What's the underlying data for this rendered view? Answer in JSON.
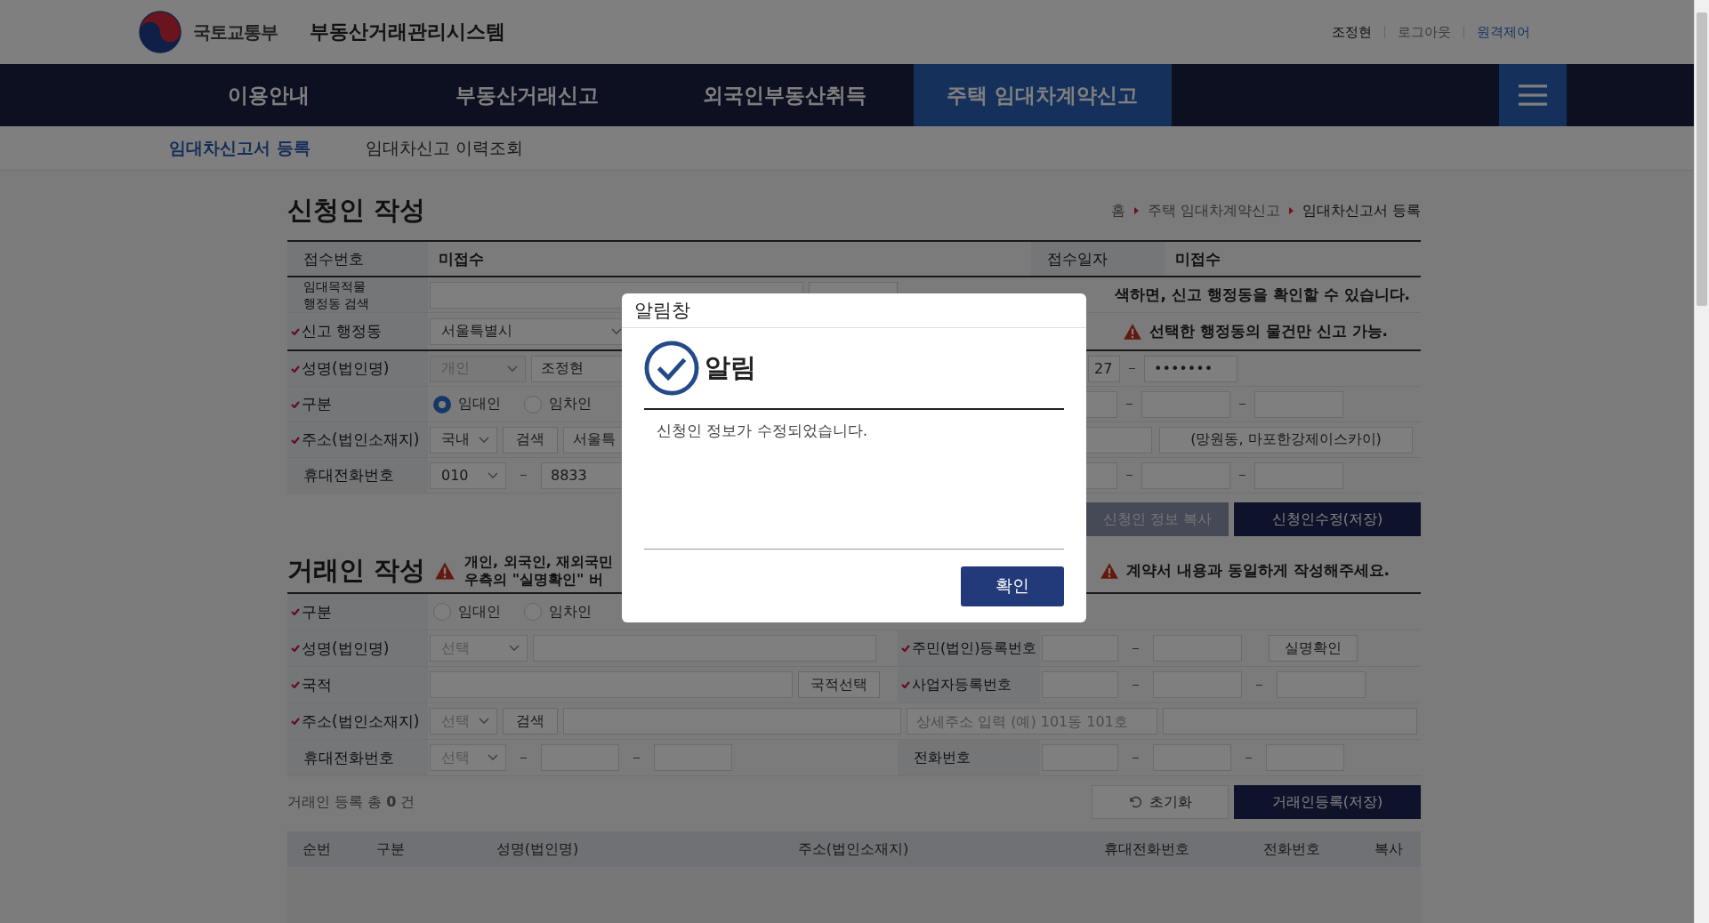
{
  "header": {
    "org": "국토교통부",
    "system": "부동산거래관리시스템",
    "links": [
      {
        "label": "조정현",
        "kind": "user"
      },
      {
        "label": "로그아웃",
        "kind": "link"
      },
      {
        "label": "원격제어",
        "kind": "remote"
      }
    ]
  },
  "nav": {
    "items": [
      {
        "label": "이용안내",
        "selected": false
      },
      {
        "label": "부동산거래신고",
        "selected": false
      },
      {
        "label": "외국인부동산취득",
        "selected": false
      },
      {
        "label": "주택 임대차계약신고",
        "selected": true
      }
    ]
  },
  "subnav": {
    "items": [
      {
        "label": "임대차신고서 등록",
        "selected": true
      },
      {
        "label": "임대차신고 이력조회",
        "selected": false
      }
    ]
  },
  "applicant": {
    "title": "신청인 작성",
    "breadcrumb": [
      "홈",
      "주택 임대차계약신고",
      "임대차신고서 등록"
    ],
    "receipt": {
      "label": "접수번호",
      "value": "미접수",
      "date_label": "접수일자",
      "date_value": "미접수"
    },
    "district_search": {
      "label_lines": [
        "임대목적물",
        "행정동 검색"
      ],
      "required": false,
      "notice": "색하면, 신고 행정동을 확인할 수 있습니다."
    },
    "district": {
      "label": "신고 행정동",
      "required": true,
      "value": "서울특별시",
      "warning": "선택한 행정동의 물건만 신고 가능."
    },
    "name": {
      "label": "성명(법인명)",
      "required": true,
      "type": {
        "value": "개인",
        "disabled": true
      },
      "value": "조정현",
      "id_front": "27",
      "id_back": "•••••••"
    },
    "category": {
      "label": "구분",
      "required": true,
      "options": [
        {
          "label": "임대인",
          "selected": true
        },
        {
          "label": "임차인",
          "selected": false
        }
      ]
    },
    "address": {
      "label": "주소(법인소재지)",
      "required": true,
      "region": "국내",
      "search": "검색",
      "value": "서울특",
      "detail": "(망원동, 마포한강제이스카이)"
    },
    "mobile": {
      "label": "휴대전화번호",
      "required": false,
      "prefix": "010",
      "middle": "8833"
    },
    "buttons": [
      {
        "label": "신청인 정보 복사",
        "kind": "secondary"
      },
      {
        "label": "신청인수정(저장)",
        "kind": "primary"
      }
    ]
  },
  "party": {
    "title": "거래인 작성",
    "note_lines": [
      "개인, 외국인, 재외국민",
      "우측의 \"**실명확인**\" 버"
    ],
    "warning": "계약서 내용과 동일하게 작성해주세요.",
    "category": {
      "label": "구분",
      "required": true,
      "options": [
        {
          "label": "임대인",
          "selected": false
        },
        {
          "label": "임차인",
          "selected": false
        }
      ]
    },
    "name": {
      "label": "성명(법인명)",
      "required": true,
      "placeholder": "선택",
      "id_label": "주민(법인)등록번호",
      "id_required": true,
      "verify": "실명확인"
    },
    "nationality": {
      "label": "국적",
      "required": true,
      "button": "국적선택",
      "biz_label": "사업자등록번호",
      "biz_required": true
    },
    "address": {
      "label": "주소(법인소재지)",
      "required": true,
      "placeholder": "선택",
      "search": "검색",
      "detail_placeholder": "상세주소 입력 (예) 101동 101호"
    },
    "mobile": {
      "label": "휴대전화번호",
      "required": false,
      "placeholder": "선택",
      "phone_label": "전화번호"
    },
    "count": "거래인 등록 총 **0** 건",
    "buttons": [
      {
        "label": "초기화",
        "kind": "reset"
      },
      {
        "label": "거래인등록(저장)",
        "kind": "primary"
      }
    ],
    "table": {
      "columns": [
        "순번",
        "구분",
        "성명(법인명)",
        "주소(법인소재지)",
        "휴대전화번호",
        "전화번호",
        "복사"
      ]
    }
  },
  "modal": {
    "title": "알림창",
    "heading": "알림",
    "message": "신청인 정보가 수정되었습니다.",
    "button": "확인"
  }
}
